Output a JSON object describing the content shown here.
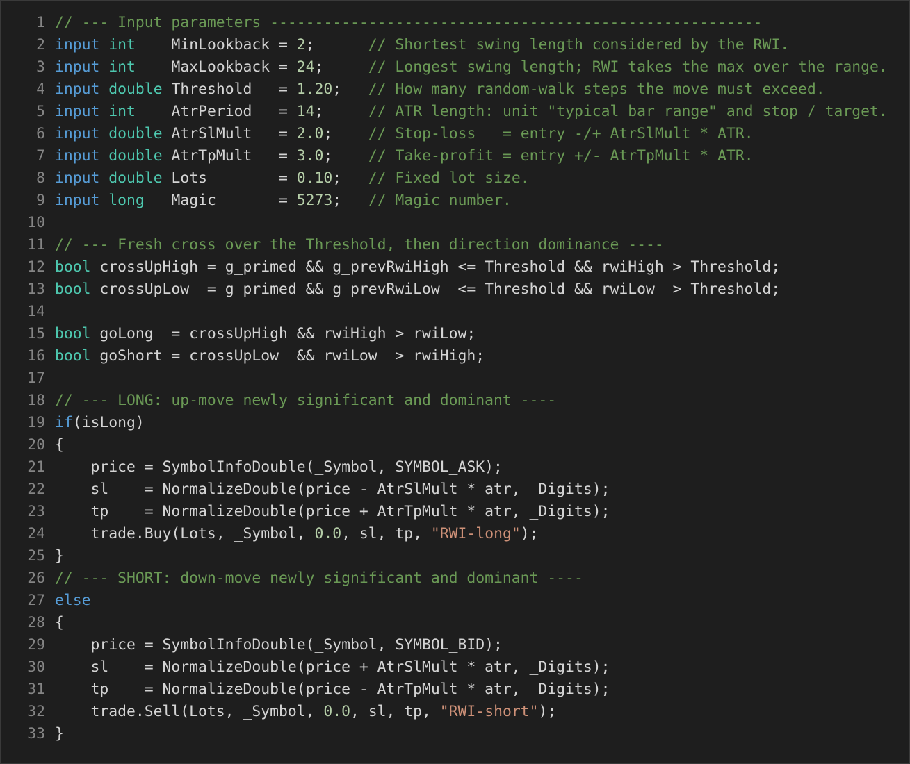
{
  "colors": {
    "background": "#1e1e1e",
    "text": "#d4d4d4",
    "line_number": "#858585",
    "keyword": "#569cd6",
    "type": "#4ec9b0",
    "comment": "#6a9955",
    "number": "#b5cea8",
    "string": "#ce9178"
  },
  "lines": [
    {
      "n": "1",
      "tokens": [
        {
          "t": "cm",
          "v": "// --- Input parameters -------------------------------------------------------"
        }
      ]
    },
    {
      "n": "2",
      "tokens": [
        {
          "t": "kw",
          "v": "input"
        },
        {
          "t": "tx",
          "v": " "
        },
        {
          "t": "ty",
          "v": "int"
        },
        {
          "t": "tx",
          "v": "    MinLookback = "
        },
        {
          "t": "nu",
          "v": "2"
        },
        {
          "t": "tx",
          "v": ";      "
        },
        {
          "t": "cm",
          "v": "// Shortest swing length considered by the RWI."
        }
      ]
    },
    {
      "n": "3",
      "tokens": [
        {
          "t": "kw",
          "v": "input"
        },
        {
          "t": "tx",
          "v": " "
        },
        {
          "t": "ty",
          "v": "int"
        },
        {
          "t": "tx",
          "v": "    MaxLookback = "
        },
        {
          "t": "nu",
          "v": "24"
        },
        {
          "t": "tx",
          "v": ";     "
        },
        {
          "t": "cm",
          "v": "// Longest swing length; RWI takes the max over the range."
        }
      ]
    },
    {
      "n": "4",
      "tokens": [
        {
          "t": "kw",
          "v": "input"
        },
        {
          "t": "tx",
          "v": " "
        },
        {
          "t": "ty",
          "v": "double"
        },
        {
          "t": "tx",
          "v": " Threshold   = "
        },
        {
          "t": "nu",
          "v": "1.20"
        },
        {
          "t": "tx",
          "v": ";   "
        },
        {
          "t": "cm",
          "v": "// How many random-walk steps the move must exceed."
        }
      ]
    },
    {
      "n": "5",
      "tokens": [
        {
          "t": "kw",
          "v": "input"
        },
        {
          "t": "tx",
          "v": " "
        },
        {
          "t": "ty",
          "v": "int"
        },
        {
          "t": "tx",
          "v": "    AtrPeriod   = "
        },
        {
          "t": "nu",
          "v": "14"
        },
        {
          "t": "tx",
          "v": ";     "
        },
        {
          "t": "cm",
          "v": "// ATR length: unit \"typical bar range\" and stop / target."
        }
      ]
    },
    {
      "n": "6",
      "tokens": [
        {
          "t": "kw",
          "v": "input"
        },
        {
          "t": "tx",
          "v": " "
        },
        {
          "t": "ty",
          "v": "double"
        },
        {
          "t": "tx",
          "v": " AtrSlMult   = "
        },
        {
          "t": "nu",
          "v": "2.0"
        },
        {
          "t": "tx",
          "v": ";    "
        },
        {
          "t": "cm",
          "v": "// Stop-loss   = entry -/+ AtrSlMult * ATR."
        }
      ]
    },
    {
      "n": "7",
      "tokens": [
        {
          "t": "kw",
          "v": "input"
        },
        {
          "t": "tx",
          "v": " "
        },
        {
          "t": "ty",
          "v": "double"
        },
        {
          "t": "tx",
          "v": " AtrTpMult   = "
        },
        {
          "t": "nu",
          "v": "3.0"
        },
        {
          "t": "tx",
          "v": ";    "
        },
        {
          "t": "cm",
          "v": "// Take-profit = entry +/- AtrTpMult * ATR."
        }
      ]
    },
    {
      "n": "8",
      "tokens": [
        {
          "t": "kw",
          "v": "input"
        },
        {
          "t": "tx",
          "v": " "
        },
        {
          "t": "ty",
          "v": "double"
        },
        {
          "t": "tx",
          "v": " Lots        = "
        },
        {
          "t": "nu",
          "v": "0.10"
        },
        {
          "t": "tx",
          "v": ";   "
        },
        {
          "t": "cm",
          "v": "// Fixed lot size."
        }
      ]
    },
    {
      "n": "9",
      "tokens": [
        {
          "t": "kw",
          "v": "input"
        },
        {
          "t": "tx",
          "v": " "
        },
        {
          "t": "ty",
          "v": "long"
        },
        {
          "t": "tx",
          "v": "   Magic       = "
        },
        {
          "t": "nu",
          "v": "5273"
        },
        {
          "t": "tx",
          "v": ";   "
        },
        {
          "t": "cm",
          "v": "// Magic number."
        }
      ]
    },
    {
      "n": "10",
      "tokens": []
    },
    {
      "n": "11",
      "tokens": [
        {
          "t": "cm",
          "v": "// --- Fresh cross over the Threshold, then direction dominance ----"
        }
      ]
    },
    {
      "n": "12",
      "tokens": [
        {
          "t": "ty",
          "v": "bool"
        },
        {
          "t": "tx",
          "v": " crossUpHigh = g_primed && g_prevRwiHigh <= Threshold && rwiHigh > Threshold;"
        }
      ]
    },
    {
      "n": "13",
      "tokens": [
        {
          "t": "ty",
          "v": "bool"
        },
        {
          "t": "tx",
          "v": " crossUpLow  = g_primed && g_prevRwiLow  <= Threshold && rwiLow  > Threshold;"
        }
      ]
    },
    {
      "n": "14",
      "tokens": []
    },
    {
      "n": "15",
      "tokens": [
        {
          "t": "ty",
          "v": "bool"
        },
        {
          "t": "tx",
          "v": " goLong  = crossUpHigh && rwiHigh > rwiLow;"
        }
      ]
    },
    {
      "n": "16",
      "tokens": [
        {
          "t": "ty",
          "v": "bool"
        },
        {
          "t": "tx",
          "v": " goShort = crossUpLow  && rwiLow  > rwiHigh;"
        }
      ]
    },
    {
      "n": "17",
      "tokens": []
    },
    {
      "n": "18",
      "tokens": [
        {
          "t": "cm",
          "v": "// --- LONG: up-move newly significant and dominant ----"
        }
      ]
    },
    {
      "n": "19",
      "tokens": [
        {
          "t": "kw",
          "v": "if"
        },
        {
          "t": "tx",
          "v": "(isLong)"
        }
      ]
    },
    {
      "n": "20",
      "tokens": [
        {
          "t": "tx",
          "v": "{"
        }
      ]
    },
    {
      "n": "21",
      "tokens": [
        {
          "t": "tx",
          "v": "    price = SymbolInfoDouble(_Symbol, SYMBOL_ASK);"
        }
      ]
    },
    {
      "n": "22",
      "tokens": [
        {
          "t": "tx",
          "v": "    sl    = NormalizeDouble(price - AtrSlMult * atr, _Digits);"
        }
      ]
    },
    {
      "n": "23",
      "tokens": [
        {
          "t": "tx",
          "v": "    tp    = NormalizeDouble(price + AtrTpMult * atr, _Digits);"
        }
      ]
    },
    {
      "n": "24",
      "tokens": [
        {
          "t": "tx",
          "v": "    trade.Buy(Lots, _Symbol, "
        },
        {
          "t": "nu",
          "v": "0.0"
        },
        {
          "t": "tx",
          "v": ", sl, tp, "
        },
        {
          "t": "st",
          "v": "\"RWI-long\""
        },
        {
          "t": "tx",
          "v": ");"
        }
      ]
    },
    {
      "n": "25",
      "tokens": [
        {
          "t": "tx",
          "v": "}"
        }
      ]
    },
    {
      "n": "26",
      "tokens": [
        {
          "t": "cm",
          "v": "// --- SHORT: down-move newly significant and dominant ----"
        }
      ]
    },
    {
      "n": "27",
      "tokens": [
        {
          "t": "kw",
          "v": "else"
        }
      ]
    },
    {
      "n": "28",
      "tokens": [
        {
          "t": "tx",
          "v": "{"
        }
      ]
    },
    {
      "n": "29",
      "tokens": [
        {
          "t": "tx",
          "v": "    price = SymbolInfoDouble(_Symbol, SYMBOL_BID);"
        }
      ]
    },
    {
      "n": "30",
      "tokens": [
        {
          "t": "tx",
          "v": "    sl    = NormalizeDouble(price + AtrSlMult * atr, _Digits);"
        }
      ]
    },
    {
      "n": "31",
      "tokens": [
        {
          "t": "tx",
          "v": "    tp    = NormalizeDouble(price - AtrTpMult * atr, _Digits);"
        }
      ]
    },
    {
      "n": "32",
      "tokens": [
        {
          "t": "tx",
          "v": "    trade.Sell(Lots, _Symbol, "
        },
        {
          "t": "nu",
          "v": "0.0"
        },
        {
          "t": "tx",
          "v": ", sl, tp, "
        },
        {
          "t": "st",
          "v": "\"RWI-short\""
        },
        {
          "t": "tx",
          "v": ");"
        }
      ]
    },
    {
      "n": "33",
      "tokens": [
        {
          "t": "tx",
          "v": "}"
        }
      ]
    }
  ]
}
